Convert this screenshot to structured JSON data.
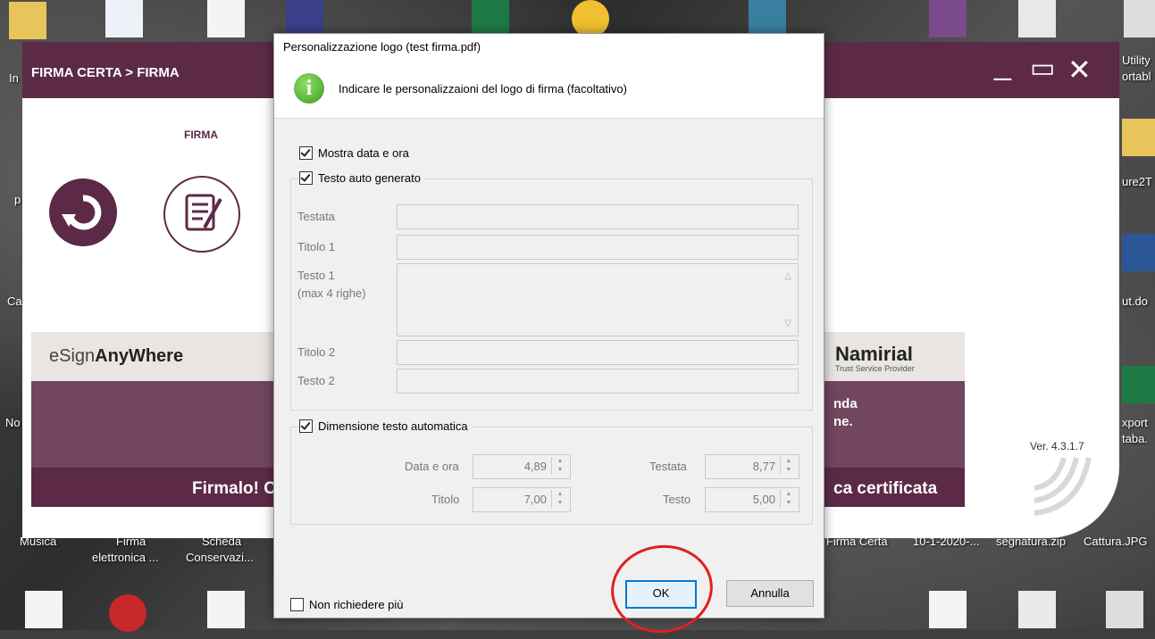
{
  "desktop": {
    "labels": [
      "In",
      "p",
      "Ca",
      "No",
      "Musica",
      "Firma",
      "elettronica ...",
      "Scheda",
      "Conservazi...",
      "Firma Certa",
      "10-1-2020-...",
      "segnatura.zip",
      "Cattura.JPG",
      "Utility",
      "ortabl",
      "ure2T",
      "ut.do",
      "xport",
      "taba."
    ]
  },
  "app": {
    "title": "FIRMA CERTA > FIRMA",
    "minimize": "_",
    "restore": "▭",
    "close": "✕",
    "tab": "FIRMA",
    "banner": {
      "esign_prefix": "eSign",
      "esign_bold": "AnyWhere",
      "left_text": "Firmalo! C",
      "right_text": "ca certificata",
      "brand": "Namirial",
      "brand_sub": "Trust Service Provider",
      "partial1": "nda",
      "partial2": "ne."
    },
    "version": "Ver. 4.3.1.7"
  },
  "dialog": {
    "title": "Personalizzazione logo (test firma.pdf)",
    "info": "Indicare le personalizzaioni del logo di firma (facoltativo)",
    "show_date": "Mostra data e ora",
    "auto_text": "Testo auto generato",
    "fields": {
      "testata": "Testata",
      "titolo1": "Titolo 1",
      "testo1": "Testo 1",
      "testo1_hint": "(max 4 righe)",
      "titolo2": "Titolo 2",
      "testo2": "Testo 2"
    },
    "auto_size": "Dimensione testo automatica",
    "sizes": {
      "data_ora_label": "Data e ora",
      "data_ora_value": "4,89",
      "testata_label": "Testata",
      "testata_value": "8,77",
      "titolo_label": "Titolo",
      "titolo_value": "7,00",
      "testo_label": "Testo",
      "testo_value": "5,00"
    },
    "dont_ask": "Non richiedere più",
    "ok": "OK",
    "cancel": "Annulla"
  },
  "colors": {
    "brand": "#5c2a46",
    "accent": "#0078d7",
    "annotation": "#e02020"
  }
}
